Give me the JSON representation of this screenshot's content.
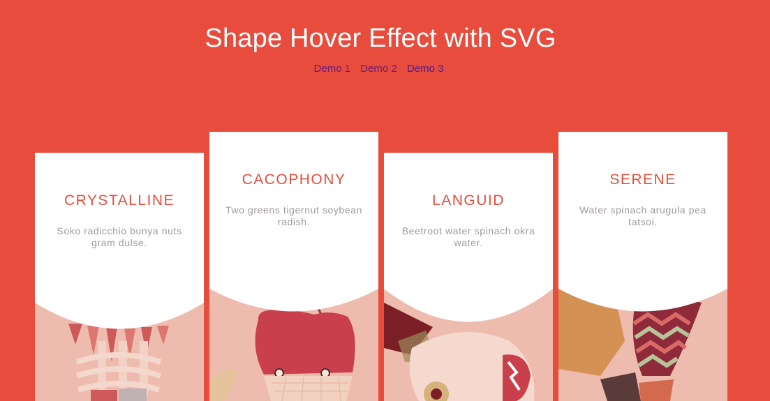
{
  "header": {
    "title": "Shape Hover Effect with SVG",
    "demos": [
      "Demo 1",
      "Demo 2",
      "Demo 3"
    ]
  },
  "cards": [
    {
      "title": "CRYSTALLINE",
      "description": "Soko radicchio bunya nuts gram dulse."
    },
    {
      "title": "CACOPHONY",
      "description": "Two greens tigernut soybean radish."
    },
    {
      "title": "LANGUID",
      "description": "Beetroot water spinach okra water."
    },
    {
      "title": "SERENE",
      "description": "Water spinach arugula pea tatsoi."
    }
  ],
  "colors": {
    "background": "#e74c3c",
    "card": "#ffffff",
    "title_accent": "#e74c3c",
    "illustration_tint": "#eebcae"
  }
}
